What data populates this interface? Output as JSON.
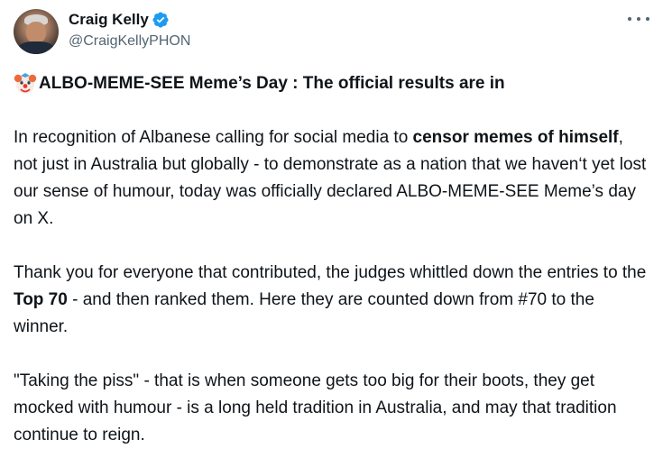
{
  "author": {
    "display_name": "Craig Kelly",
    "handle": "@CraigKellyPHON",
    "verified": true
  },
  "icons": {
    "avatar": "avatar",
    "verified": "verified-badge-icon",
    "more": "more-options-icon",
    "emoji": "clown-face-icon"
  },
  "colors": {
    "verified_blue": "#1d9bf0",
    "text_primary": "#0f1419",
    "text_secondary": "#536471"
  },
  "tweet": {
    "title": "ALBO-MEME-SEE Meme’s Day : The official results are in",
    "p1_a": "In recognition of Albanese calling for social media to ",
    "p1_b": "censor memes of himself",
    "p1_c": ", not just in Australia but  globally  -  to demonstrate as a nation that we haven‘t yet lost our sense of humour, today was officially declared ALBO-MEME-SEE Meme’s day on X.",
    "p2_a": "Thank you for everyone that contributed, the judges whittled down the entries to the ",
    "p2_b": "Top 70",
    "p2_c": " - and  then ranked them.  Here they are counted down from  #70 to the winner.",
    "p3": "\"Taking the piss\" - that is when someone gets too big for their boots, they get mocked with humour  - is a long  held tradition in Australia, and may that tradition continue to reign."
  }
}
